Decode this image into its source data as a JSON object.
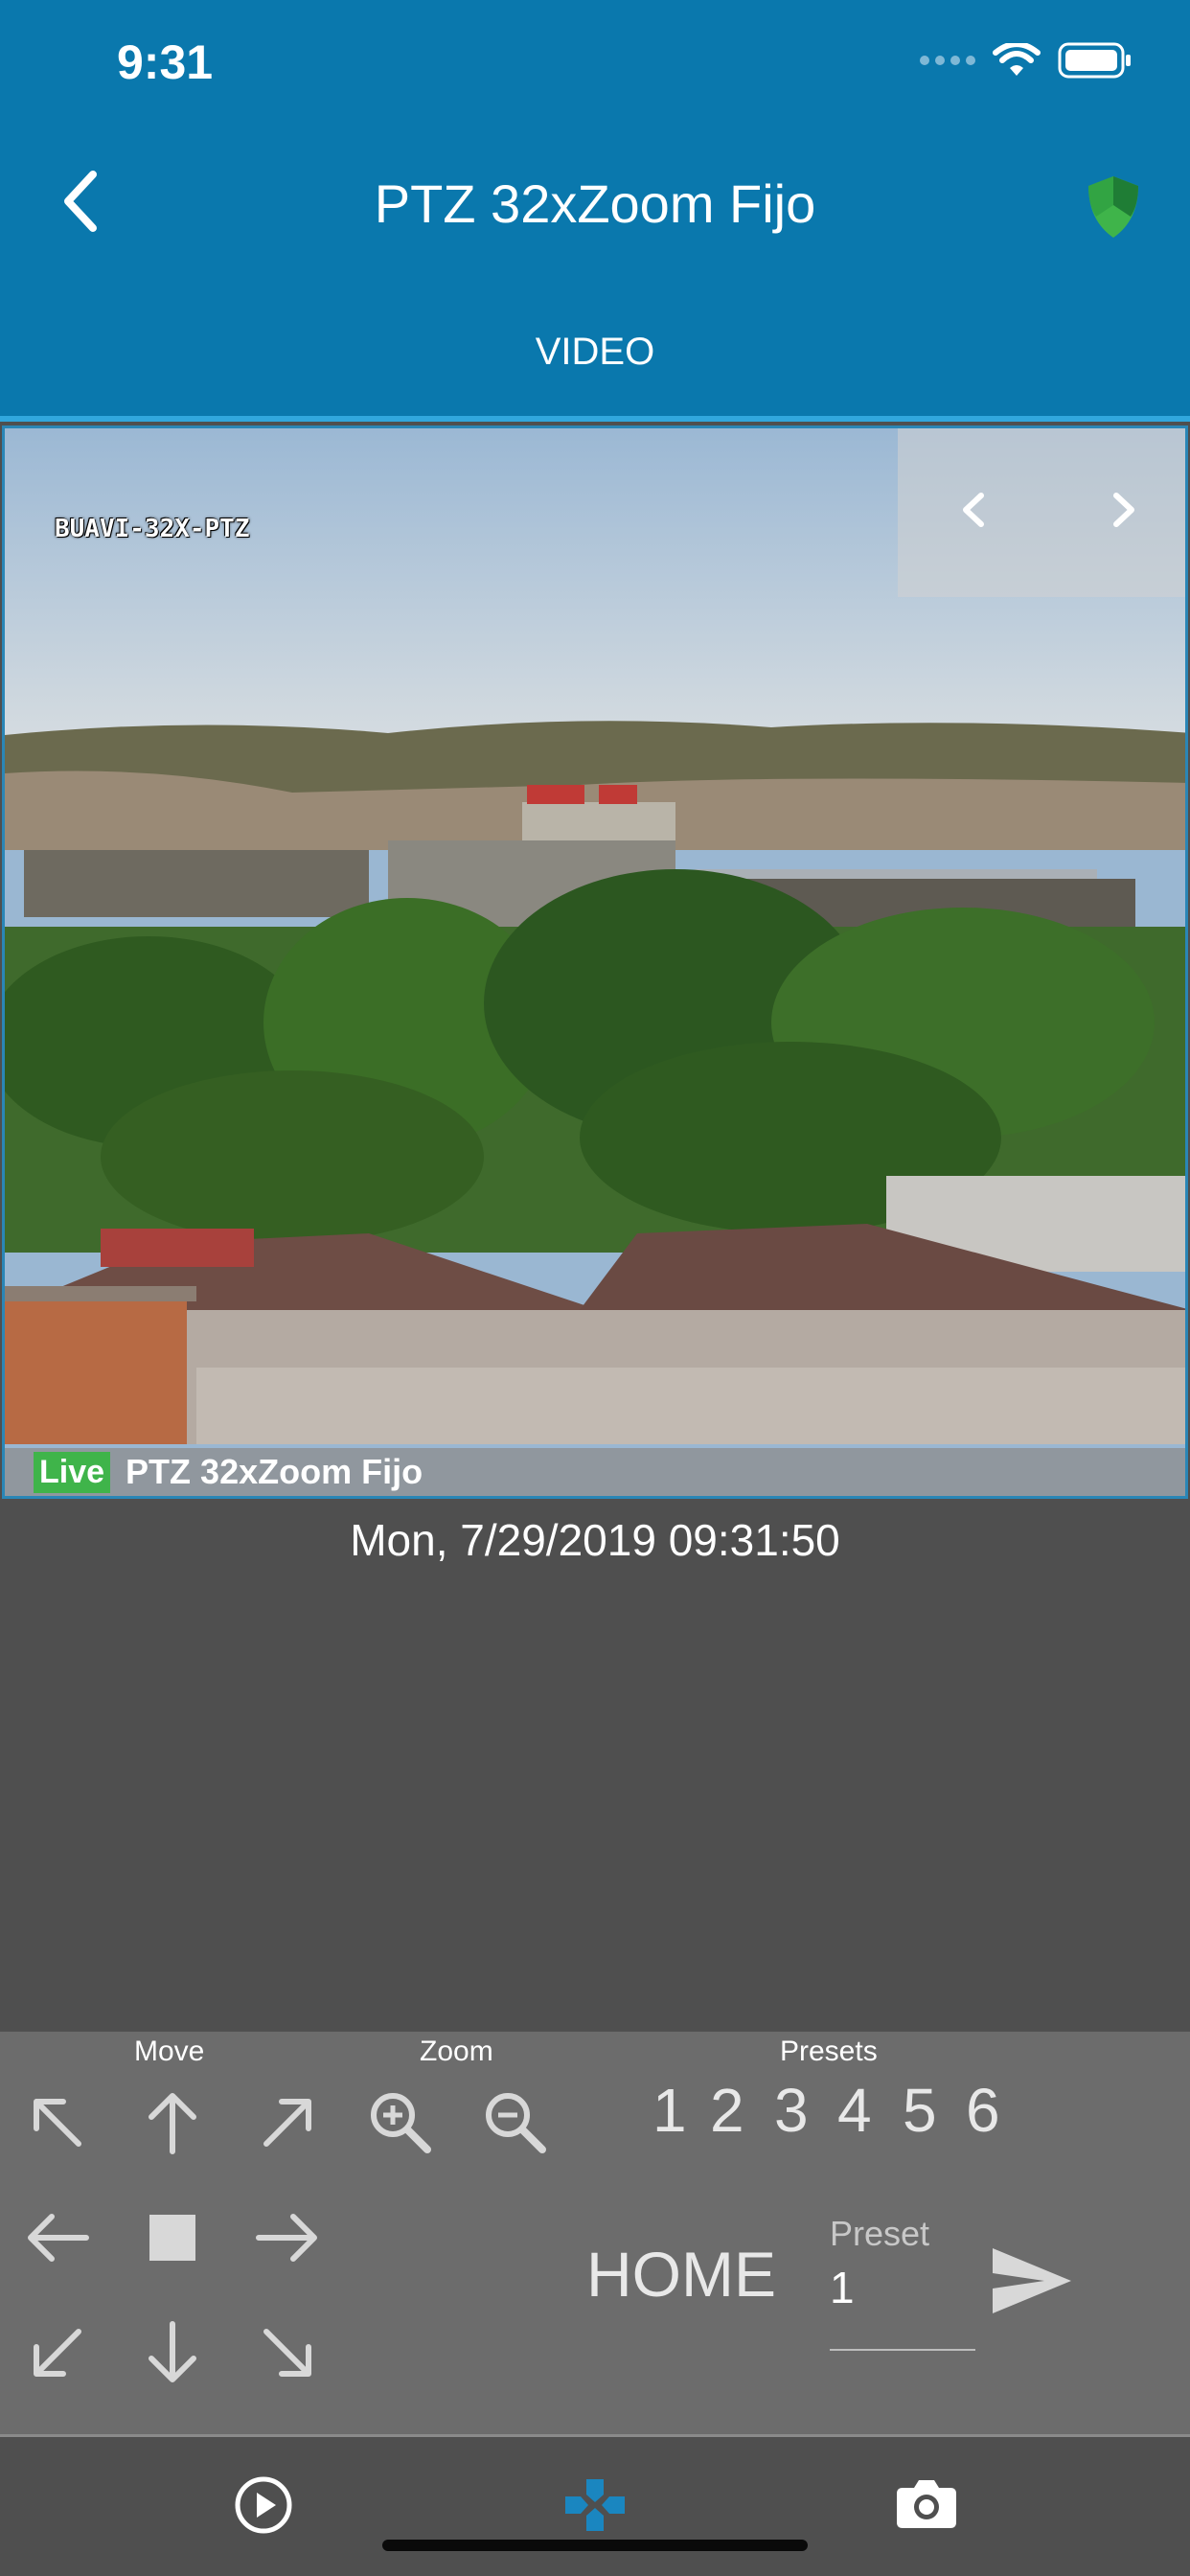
{
  "status_bar": {
    "time": "9:31"
  },
  "header": {
    "title": "PTZ 32xZoom Fijo",
    "back_icon": "chevron-left-icon",
    "security_icon": "shield-icon"
  },
  "tabs": {
    "active": "VIDEO"
  },
  "video": {
    "camera_overlay_label": "BUAVI-32X-PTZ",
    "live_badge": "Live",
    "camera_name": "PTZ 32xZoom Fijo",
    "timestamp": "Mon, 7/29/2019 09:31:50"
  },
  "controls": {
    "move_label": "Move",
    "zoom_label": "Zoom",
    "presets_label": "Presets",
    "presets": [
      "1",
      "2",
      "3",
      "4",
      "5",
      "6"
    ],
    "home_label": "HOME",
    "preset_input": {
      "placeholder": "Preset",
      "value": "1"
    }
  },
  "bottom_nav": {
    "items": [
      "play-icon",
      "gamepad-icon",
      "camera-icon"
    ],
    "active": "gamepad-icon"
  },
  "colors": {
    "header": "#0a78ad",
    "accent": "#31a7dd",
    "live": "#3fb44a",
    "shield": "#3fb44a"
  }
}
